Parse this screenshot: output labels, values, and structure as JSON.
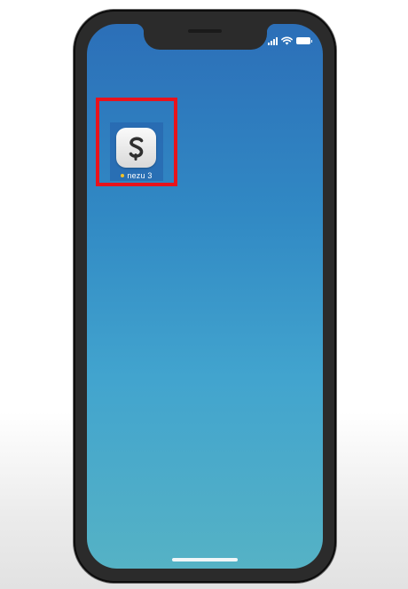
{
  "home_screen": {
    "apps": [
      {
        "label": "nezu 3",
        "icon": "nezu-s-logo-icon",
        "has_update_dot": true
      }
    ]
  },
  "status_bar": {
    "icons": [
      "cellular-signal-icon",
      "wifi-icon",
      "battery-icon"
    ]
  },
  "colors": {
    "wallpaper_top": "#2c6fb8",
    "wallpaper_bottom": "#55b2c5",
    "highlight": "#e8131c",
    "update_dot": "#f2c228"
  }
}
